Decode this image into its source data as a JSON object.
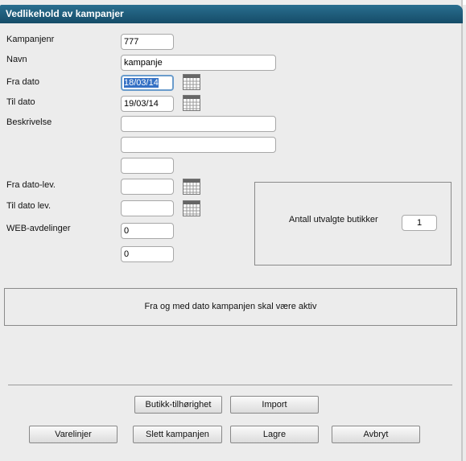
{
  "window": {
    "title": "Vedlikehold av kampanjer"
  },
  "form": {
    "kampanjenr": {
      "label": "Kampanjenr",
      "value": "777"
    },
    "navn": {
      "label": "Navn",
      "value": "kampanje"
    },
    "fra_dato": {
      "label": "Fra dato",
      "value": "18/03/14"
    },
    "til_dato": {
      "label": "Til dato",
      "value": "19/03/14"
    },
    "beskrivelse": {
      "label": "Beskrivelse",
      "line1": "",
      "line2": "",
      "line3": ""
    },
    "fra_dato_lev": {
      "label": "Fra dato-lev.",
      "value": ""
    },
    "til_dato_lev": {
      "label": "Til dato lev.",
      "value": ""
    },
    "web_avdelinger": {
      "label": "WEB-avdelinger",
      "value1": "0",
      "value2": "0"
    }
  },
  "stores_panel": {
    "label": "Antall utvalgte butikker",
    "count": "1"
  },
  "info_panel": {
    "text": "Fra og med dato kampanjen skal være aktiv"
  },
  "buttons": {
    "butikk_tilhorighet": "Butikk-tilhørighet",
    "import": "Import",
    "varelinjer": "Varelinjer",
    "slett": "Slett kampanjen",
    "lagre": "Lagre",
    "avbryt": "Avbryt"
  },
  "icons": {
    "calendar": "calendar-icon"
  }
}
